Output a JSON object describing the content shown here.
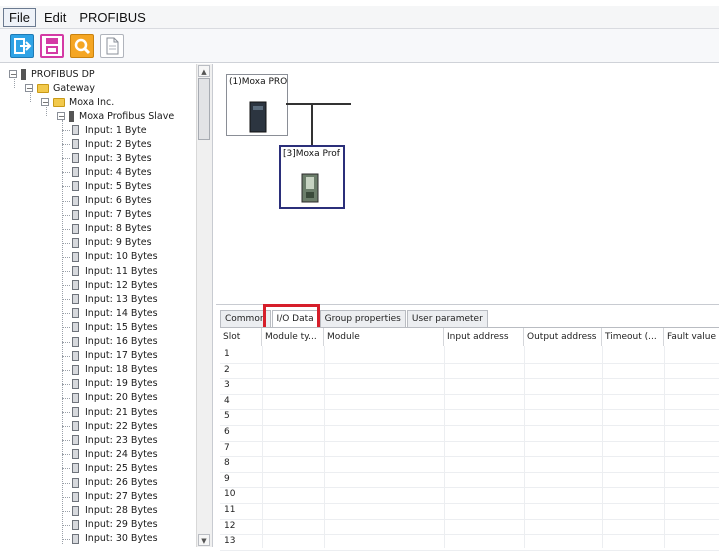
{
  "menu": {
    "items": [
      "File",
      "Edit",
      "PROFIBUS"
    ]
  },
  "toolbar": {
    "icons": [
      "exit-icon",
      "save-icon",
      "search-icon",
      "document-icon"
    ]
  },
  "tree": {
    "root": "PROFIBUS DP",
    "category": "Gateway",
    "vendor": "Moxa Inc.",
    "device": "Moxa Profibus Slave",
    "modules": [
      "Input: 1 Byte",
      "Input: 2 Bytes",
      "Input: 3 Bytes",
      "Input: 4 Bytes",
      "Input: 5 Bytes",
      "Input: 6 Bytes",
      "Input: 7 Bytes",
      "Input: 8 Bytes",
      "Input: 9 Bytes",
      "Input: 10 Bytes",
      "Input: 11 Bytes",
      "Input: 12 Bytes",
      "Input: 13 Bytes",
      "Input: 14 Bytes",
      "Input: 15 Bytes",
      "Input: 16 Bytes",
      "Input: 17 Bytes",
      "Input: 18 Bytes",
      "Input: 19 Bytes",
      "Input: 20 Bytes",
      "Input: 21 Bytes",
      "Input: 22 Bytes",
      "Input: 23 Bytes",
      "Input: 24 Bytes",
      "Input: 25 Bytes",
      "Input: 26 Bytes",
      "Input: 27 Bytes",
      "Input: 28 Bytes",
      "Input: 29 Bytes",
      "Input: 30 Bytes"
    ]
  },
  "network": {
    "node1_label": "(1)Moxa PRO",
    "node2_label": "[3]Moxa Prof"
  },
  "tabs": [
    "Common",
    "I/O Data",
    "Group properties",
    "User parameter"
  ],
  "active_tab": "I/O Data",
  "table": {
    "columns": [
      "Slot",
      "Module ty...",
      "Module",
      "Input address",
      "Output address",
      "Timeout (...",
      "Fault value"
    ],
    "slots": [
      "1",
      "2",
      "3",
      "4",
      "5",
      "6",
      "7",
      "8",
      "9",
      "10",
      "11",
      "12",
      "13"
    ]
  },
  "colors": {
    "highlight": "#d61e2a",
    "selected_node_border": "#2b2f7a"
  }
}
